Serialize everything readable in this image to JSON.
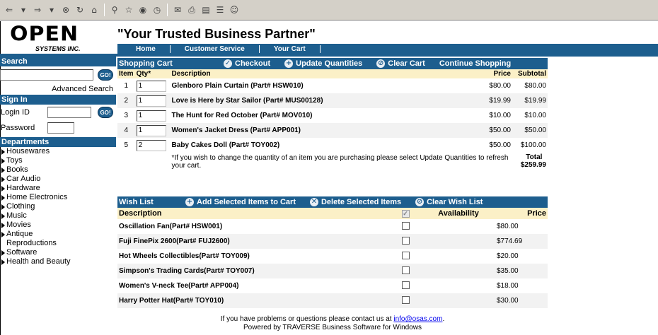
{
  "browser_toolbar": {
    "icons": [
      "back-icon",
      "dropdown-icon",
      "forward-icon",
      "dropdown-icon",
      "stop-icon",
      "refresh-icon",
      "home-icon",
      "search-icon",
      "favorites-icon",
      "media-icon",
      "history-icon",
      "mail-icon",
      "print-icon",
      "edit-icon",
      "discuss-icon",
      "messenger-icon"
    ]
  },
  "logo": {
    "word": "OPEN",
    "sub": "SYSTEMS INC."
  },
  "slogan": "\"Your Trusted Business Partner\"",
  "topnav": [
    "Home",
    "Customer Service",
    "Your Cart"
  ],
  "sidebar": {
    "search_title": "Search",
    "go_label": "GO!",
    "advanced_search": "Advanced Search",
    "signin_title": "Sign In",
    "login_label": "Login ID",
    "password_label": "Password",
    "departments_title": "Departments",
    "departments": [
      "Housewares",
      "Toys",
      "Books",
      "Car Audio",
      "Hardware",
      "Home Electronics",
      "Clothing",
      "Music",
      "Movies",
      "Antique Reproductions",
      "Software",
      "Health and Beauty"
    ]
  },
  "cart": {
    "title": "Shopping Cart",
    "actions": [
      {
        "label": "Checkout",
        "icon": "checkmark-icon"
      },
      {
        "label": "Update Quantities",
        "icon": "plus-icon"
      },
      {
        "label": "Clear Cart",
        "icon": "clear-icon"
      },
      {
        "label": "Continue Shopping",
        "icon": ""
      }
    ],
    "columns": {
      "item": "Item",
      "qty": "Qty*",
      "description": "Description",
      "price": "Price",
      "subtotal": "Subtotal"
    },
    "rows": [
      {
        "item": "1",
        "qty": "1",
        "description": "Glenboro Plain Curtain (Part# HSW010)",
        "price": "$80.00",
        "subtotal": "$80.00"
      },
      {
        "item": "2",
        "qty": "1",
        "description": "Love is Here by Star Sailor (Part# MUS00128)",
        "price": "$19.99",
        "subtotal": "$19.99"
      },
      {
        "item": "3",
        "qty": "1",
        "description": "The Hunt for Red October (Part# MOV010)",
        "price": "$10.00",
        "subtotal": "$10.00"
      },
      {
        "item": "4",
        "qty": "1",
        "description": "Women's Jacket Dress (Part# APP001)",
        "price": "$50.00",
        "subtotal": "$50.00"
      },
      {
        "item": "5",
        "qty": "2",
        "description": "Baby Cakes Doll (Part# TOY002)",
        "price": "$50.00",
        "subtotal": "$100.00"
      }
    ],
    "note": "*If you wish to change the quantity of an item you are purchasing please select Update Quantities to refresh your cart.",
    "total_label": "Total",
    "total_value": "$259.99"
  },
  "wishlist": {
    "title": "Wish List",
    "actions": [
      {
        "label": "Add Selected Items to Cart",
        "icon": "plus-icon"
      },
      {
        "label": "Delete Selected Items",
        "icon": "delete-icon"
      },
      {
        "label": "Clear Wish List",
        "icon": "clear-icon"
      }
    ],
    "columns": {
      "description": "Description",
      "availability": "Availability",
      "price": "Price"
    },
    "rows": [
      {
        "description": "Oscillation Fan(Part# HSW001)",
        "price": "$80.00"
      },
      {
        "description": "Fuji FinePix 2600(Part# FUJ2600)",
        "price": "$774.69"
      },
      {
        "description": "Hot Wheels Collectibles(Part# TOY009)",
        "price": "$20.00"
      },
      {
        "description": "Simpson's Trading Cards(Part# TOY007)",
        "price": "$35.00"
      },
      {
        "description": "Women's V-neck Tee(Part# APP004)",
        "price": "$18.00"
      },
      {
        "description": "Harry Potter Hat(Part# TOY010)",
        "price": "$30.00"
      }
    ]
  },
  "footer": {
    "line1_prefix": "If you have problems or questions please contact us at ",
    "email": "info@osas.com",
    "line1_suffix": ".",
    "line2": "Powered by TRAVERSE Business Software for Windows"
  },
  "colors": {
    "primary": "#1d5e8e",
    "header_bg": "#fbf0c7",
    "row_alt": "#f2f2f2"
  }
}
